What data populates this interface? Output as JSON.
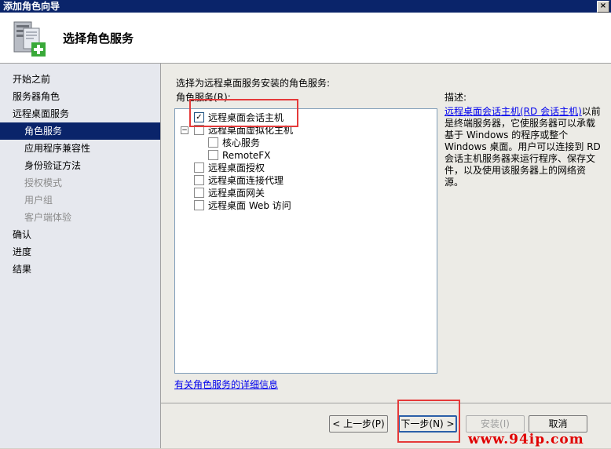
{
  "window": {
    "title": "添加角色向导",
    "close_glyph": "×"
  },
  "header": {
    "title": "选择角色服务",
    "icon": "server-add-icon"
  },
  "nav": {
    "items": [
      {
        "label": "开始之前",
        "level": 1,
        "state": "normal"
      },
      {
        "label": "服务器角色",
        "level": 1,
        "state": "normal"
      },
      {
        "label": "远程桌面服务",
        "level": 1,
        "state": "normal"
      },
      {
        "label": "角色服务",
        "level": 2,
        "state": "selected"
      },
      {
        "label": "应用程序兼容性",
        "level": 2,
        "state": "normal"
      },
      {
        "label": "身份验证方法",
        "level": 2,
        "state": "normal"
      },
      {
        "label": "授权模式",
        "level": 2,
        "state": "disabled"
      },
      {
        "label": "用户组",
        "level": 2,
        "state": "disabled"
      },
      {
        "label": "客户端体验",
        "level": 2,
        "state": "disabled"
      },
      {
        "label": "确认",
        "level": 1,
        "state": "normal"
      },
      {
        "label": "进度",
        "level": 1,
        "state": "normal"
      },
      {
        "label": "结果",
        "level": 1,
        "state": "normal"
      }
    ]
  },
  "main": {
    "prompt": "选择为远程桌面服务安装的角色服务:",
    "list_caption": "角色服务(R):",
    "role_services": [
      {
        "label": "远程桌面会话主机",
        "checked": true
      },
      {
        "label": "远程桌面虚拟化主机",
        "checked": false,
        "expander": "−"
      },
      {
        "label": "核心服务",
        "checked": false
      },
      {
        "label": "RemoteFX",
        "checked": false
      },
      {
        "label": "远程桌面授权",
        "checked": false
      },
      {
        "label": "远程桌面连接代理",
        "checked": false
      },
      {
        "label": "远程桌面网关",
        "checked": false
      },
      {
        "label": "远程桌面 Web 访问",
        "checked": false
      }
    ],
    "check_glyph": "✓",
    "description": {
      "title": "描述:",
      "link": "远程桌面会话主机(RD 会话主机)",
      "text": "以前是终端服务器，它使服务器可以承载基于 Windows 的程序或整个 Windows 桌面。用户可以连接到 RD 会话主机服务器来运行程序、保存文件，以及使用该服务器上的网络资源。"
    },
    "more_info_link": "有关角色服务的详细信息"
  },
  "buttons": {
    "previous": "< 上一步(P)",
    "next": "下一步(N) >",
    "install": "安装(I)",
    "cancel": "取消"
  },
  "watermark": "www.94ip.com",
  "colors": {
    "highlight_box": "#e53a3a",
    "nav_selected": "#0a246a",
    "watermark": "#e00000"
  }
}
